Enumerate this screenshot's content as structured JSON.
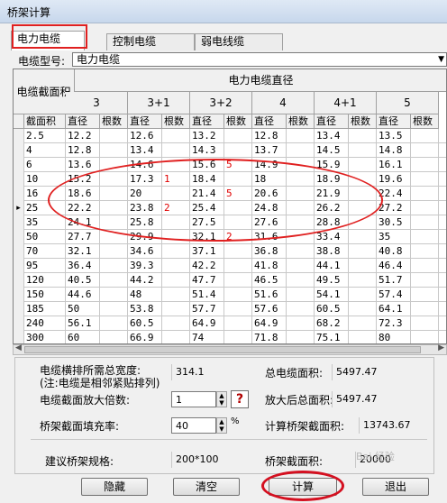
{
  "window": {
    "title": "桥架计算"
  },
  "tabs": [
    {
      "label": "电力电缆",
      "active": true
    },
    {
      "label": "控制电缆",
      "active": false
    },
    {
      "label": "弱电线缆",
      "active": false
    }
  ],
  "cable_type": {
    "label": "电缆型号:",
    "value": "电力电缆"
  },
  "grid": {
    "header_section": "电缆截面积",
    "header_group": "电力电缆直径",
    "core_types": [
      "3",
      "3+1",
      "3+2",
      "4",
      "4+1",
      "5"
    ],
    "col_area": "截面积",
    "col_diameter": "直径",
    "col_count": "根数",
    "current_row_marker": "▸",
    "rows": [
      {
        "area": "2.5",
        "cells": [
          "12.2",
          "",
          "12.6",
          "",
          "13.2",
          "",
          "12.8",
          "",
          "13.4",
          "",
          "13.5",
          ""
        ]
      },
      {
        "area": "4",
        "cells": [
          "12.8",
          "",
          "13.4",
          "",
          "14.3",
          "",
          "13.7",
          "",
          "14.5",
          "",
          "14.8",
          ""
        ]
      },
      {
        "area": "6",
        "cells": [
          "13.6",
          "",
          "14.6",
          "",
          "15.6",
          "5",
          "14.9",
          "",
          "15.9",
          "",
          "16.1",
          ""
        ]
      },
      {
        "area": "10",
        "cells": [
          "15.2",
          "",
          "17.3",
          "1",
          "18.4",
          "",
          "18",
          "",
          "18.9",
          "",
          "19.6",
          ""
        ]
      },
      {
        "area": "16",
        "cells": [
          "18.6",
          "",
          "20",
          "",
          "21.4",
          "5",
          "20.6",
          "",
          "21.9",
          "",
          "22.4",
          ""
        ]
      },
      {
        "area": "25",
        "cells": [
          "22.2",
          "",
          "23.8",
          "2",
          "25.4",
          "",
          "24.8",
          "",
          "26.2",
          "",
          "27.2",
          ""
        ]
      },
      {
        "area": "35",
        "cells": [
          "24.1",
          "",
          "25.8",
          "",
          "27.5",
          "",
          "27.6",
          "",
          "28.8",
          "",
          "30.5",
          ""
        ]
      },
      {
        "area": "50",
        "cells": [
          "27.7",
          "",
          "29.9",
          "",
          "32.1",
          "2",
          "31.6",
          "",
          "33.4",
          "",
          "35",
          ""
        ]
      },
      {
        "area": "70",
        "cells": [
          "32.1",
          "",
          "34.6",
          "",
          "37.1",
          "",
          "36.8",
          "",
          "38.8",
          "",
          "40.8",
          ""
        ]
      },
      {
        "area": "95",
        "cells": [
          "36.4",
          "",
          "39.3",
          "",
          "42.2",
          "",
          "41.8",
          "",
          "44.1",
          "",
          "46.4",
          ""
        ]
      },
      {
        "area": "120",
        "cells": [
          "40.5",
          "",
          "44.2",
          "",
          "47.7",
          "",
          "46.5",
          "",
          "49.5",
          "",
          "51.7",
          ""
        ]
      },
      {
        "area": "150",
        "cells": [
          "44.6",
          "",
          "48",
          "",
          "51.4",
          "",
          "51.6",
          "",
          "54.1",
          "",
          "57.4",
          ""
        ]
      },
      {
        "area": "185",
        "cells": [
          "50",
          "",
          "53.8",
          "",
          "57.7",
          "",
          "57.6",
          "",
          "60.5",
          "",
          "64.1",
          ""
        ]
      },
      {
        "area": "240",
        "cells": [
          "56.1",
          "",
          "60.5",
          "",
          "64.9",
          "",
          "64.9",
          "",
          "68.2",
          "",
          "72.3",
          ""
        ]
      },
      {
        "area": "300",
        "cells": [
          "60",
          "",
          "66.9",
          "",
          "74",
          "",
          "71.8",
          "",
          "75.1",
          "",
          "80",
          ""
        ]
      }
    ],
    "current_row_index": 5
  },
  "results": {
    "total_width_label": "电缆横排所需总宽度:",
    "total_width_note": "(注:电缆是相邻紧贴排列)",
    "total_width_value": "314.1",
    "total_area_label": "总电缆面积:",
    "total_area_value": "5497.47",
    "multiplier_label": "电缆截面放大倍数:",
    "multiplier_value": "1",
    "help_label": "?",
    "enlarged_area_label": "放大后总面积:",
    "enlarged_area_value": "5497.47",
    "fill_rate_label": "桥架截面填充率:",
    "fill_rate_value": "40",
    "fill_rate_unit": "%",
    "tray_area_label": "计算桥架截面积:",
    "tray_area_value": "13743.67",
    "suggested_spec_label": "建议桥架规格:",
    "suggested_spec_value": "200*100",
    "tray_section_label": "桥架截面积:",
    "tray_section_value": "20000"
  },
  "buttons": {
    "hide": "隐藏",
    "clear": "清空",
    "calculate": "计算",
    "exit": "退出"
  },
  "watermark": "Bai 经验",
  "colors": {
    "annotation_red": "#e02020",
    "count_red": "#e00000"
  }
}
